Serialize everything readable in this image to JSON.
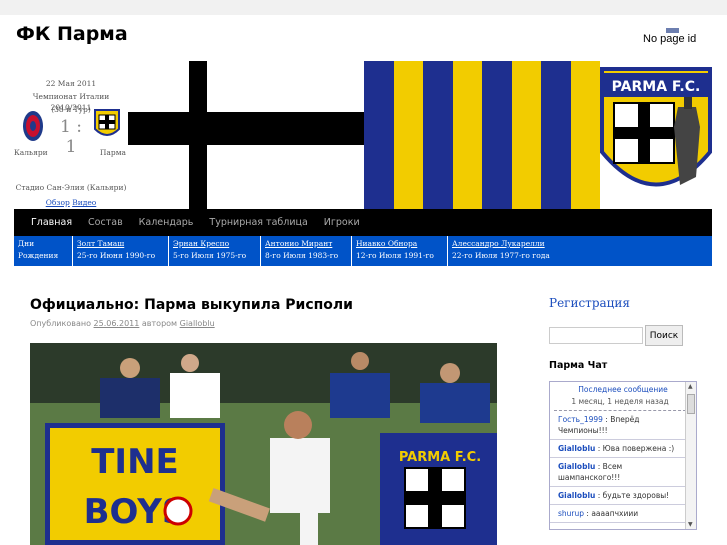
{
  "site": {
    "title": "ФК Парма",
    "ad_text": "No page id"
  },
  "match": {
    "date": "22 Мая 2011",
    "tournament": "Чемпионат Италии 2010/2011",
    "round": "(38-й Тур)",
    "score": "1 : 1",
    "home": "Кальяри",
    "away": "Парма",
    "stadium": "Стадио Сан-Элия (Кальяри)",
    "link_review": "Обзор",
    "link_video": "Видео"
  },
  "banner": {
    "crest_text": "PARMA F.C.",
    "colors": {
      "yellow": "#f2cc00",
      "blue": "#1e2f8f",
      "black": "#000000"
    }
  },
  "nav": {
    "items": [
      "Главная",
      "Состав",
      "Календарь",
      "Турнирная таблица",
      "Игроки"
    ]
  },
  "birthdays": {
    "header_1": "Дни",
    "header_2": "Рождения",
    "people": [
      {
        "name": "Золт Тамаш",
        "date": "25-го Июня 1990-го года"
      },
      {
        "name": "Эрнан Креспо",
        "date": "5-го Июля 1975-го года"
      },
      {
        "name": "Антонио Мирант",
        "date": "8-го Июля 1983-го года"
      },
      {
        "name": "Ниавко Обнора",
        "date": "12-го Июля 1991-го года"
      },
      {
        "name": "Алессандро Лукарелли",
        "date": "22-го Июля 1977-го года"
      }
    ]
  },
  "post": {
    "title": "Официально: Парма выкупила Рисполи",
    "meta_prefix": "Опубликовано",
    "date": "25.06.2011",
    "meta_author_prefix": "автором",
    "author": "Gialloblu",
    "banner_text_1": "TINE",
    "banner_text_2": "BOYS",
    "banner_text_3": "PARMA F.C."
  },
  "sidebar": {
    "register": "Регистрация",
    "search_button": "Поиск",
    "chat_title": "Парма Чат",
    "chat_last": "Последнее сообщение",
    "chat_last_time": "1 месяц, 1 неделя назад",
    "messages": [
      {
        "user": "Гость_1999",
        "text": "Вперёд Чемпионы!!!"
      },
      {
        "user": "Gialloblu",
        "text": "Юва повержена :)"
      },
      {
        "user": "Gialloblu",
        "text": "Всем шампанского!!!"
      },
      {
        "user": "Gialloblu",
        "text": "будьте здоровы!"
      },
      {
        "user": "shurup",
        "text": "аааапчхиии"
      }
    ]
  }
}
